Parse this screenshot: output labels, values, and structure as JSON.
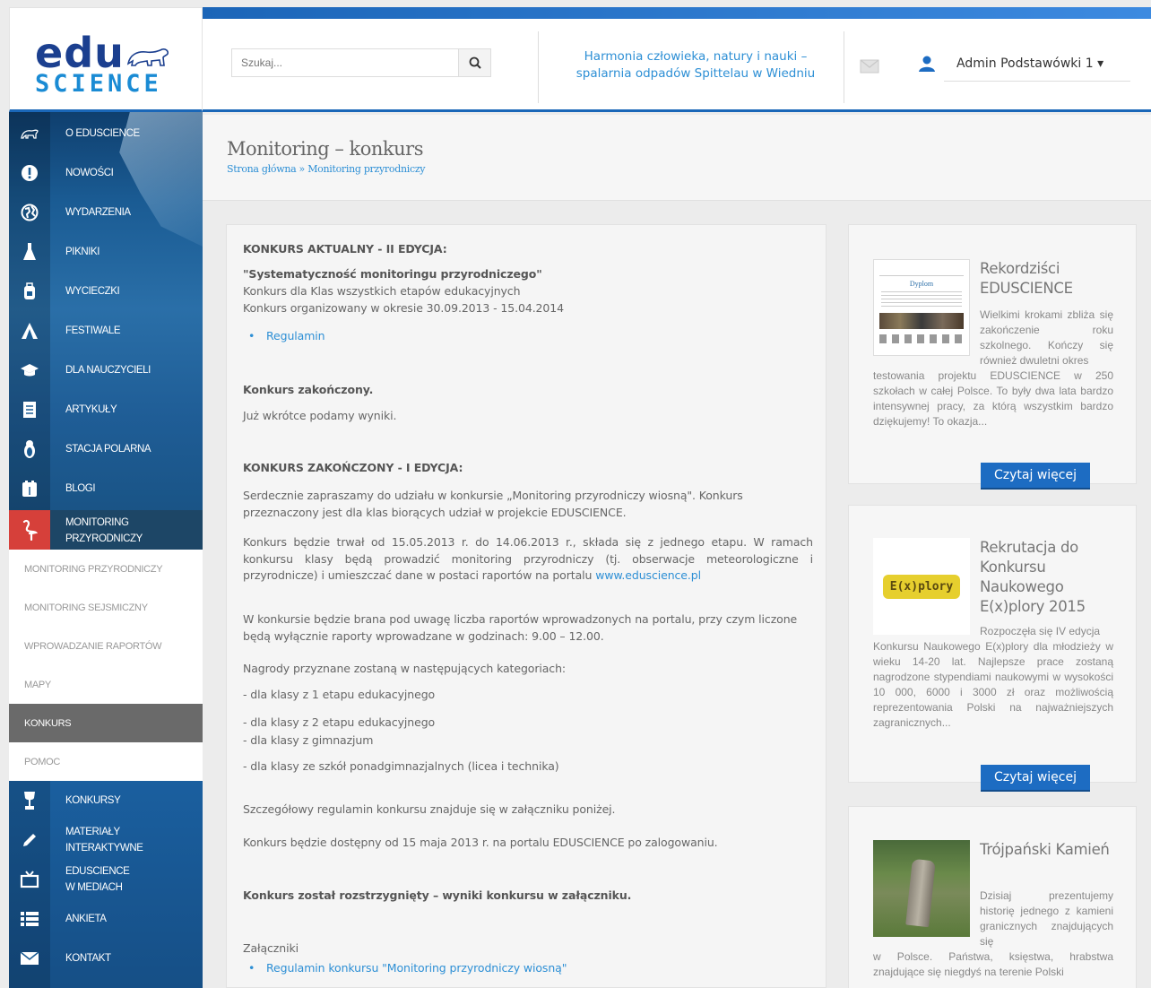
{
  "brand": {
    "logo_top": "edu",
    "logo_bottom": "SCIENCE"
  },
  "search": {
    "placeholder": "Szukaj..."
  },
  "headline": {
    "line1": "Harmonia człowieka, natury i nauki –",
    "line2": "spalarnia odpadów Spittelau w Wiedniu"
  },
  "user": {
    "label": "Admin Podstawówki 1 ▾"
  },
  "sidebar": {
    "top_items": [
      {
        "label": "O EDUSCIENCE",
        "icon": "bear-icon"
      },
      {
        "label": "NOWOŚCI",
        "icon": "exclamation-icon"
      },
      {
        "label": "WYDARZENIA",
        "icon": "globe-icon"
      },
      {
        "label": "PIKNIKI",
        "icon": "flask-icon"
      },
      {
        "label": "WYCIECZKI",
        "icon": "backpack-icon"
      },
      {
        "label": "FESTIWALE",
        "icon": "tent-icon"
      },
      {
        "label": "DLA NAUCZYCIELI",
        "icon": "graduation-cap-icon"
      },
      {
        "label": "ARTYKUŁY",
        "icon": "document-icon"
      },
      {
        "label": "STACJA POLARNA",
        "icon": "penguin-icon"
      },
      {
        "label": "BLOGI",
        "icon": "blog-icon"
      }
    ],
    "active": {
      "line1": "MONITORING",
      "line2": "PRZYRODNICZY",
      "icon": "flamingo-icon"
    },
    "sub_items": [
      "MONITORING PRZYRODNICZY",
      "MONITORING SEJSMICZNY",
      "WPROWADZANIE RAPORTÓW",
      "MAPY",
      "KONKURS",
      "POMOC"
    ],
    "bottom_items": [
      {
        "line1": "KONKURSY",
        "line2": "",
        "icon": "trophy-icon"
      },
      {
        "line1": "MATERIAŁY",
        "line2": "INTERAKTYWNE",
        "icon": "pencil-icon"
      },
      {
        "line1": "EDUSCIENCE",
        "line2": "W MEDIACH",
        "icon": "tv-icon"
      },
      {
        "line1": "ANKIETA",
        "line2": "",
        "icon": "list-icon"
      },
      {
        "line1": "KONTAKT",
        "line2": "",
        "icon": "envelope-icon"
      }
    ]
  },
  "page": {
    "title": "Monitoring – konkurs",
    "breadcrumb": "Strona główna » Monitoring przyrodniczy"
  },
  "article": {
    "h1": "KONKURS AKTUALNY - II EDYCJA:",
    "quote": "\"Systematyczność monitoringu przyrodniczego\"",
    "line_a": "Konkurs dla Klas wszystkich etapów edukacyjnych",
    "line_b": "Konkurs organizowany w okresie 30.09.2013 - 15.04.2014",
    "regulamin": "Regulamin",
    "ended_bold": "Konkurs zakończony.",
    "soon": "Już wkrótce podamy wyniki.",
    "h2": "KONKURS ZAKOŃCZONY - I EDYCJA:",
    "p1": "Serdecznie zapraszamy do udziału w konkursie „Monitoring przyrodniczy wiosną\". Konkurs przeznaczony jest dla klas biorących udział w projekcie EDUSCIENCE.",
    "p2": "Konkurs będzie trwał od 15.05.2013 r. do 14.06.2013 r., składa się z jednego etapu. W ramach konkursu klasy będą prowadzić monitoring przyrodniczy (tj. obserwacje meteorologiczne i przyrodnicze) i umieszczać dane w postaci raportów na portalu",
    "p2_link": "www.eduscience.pl",
    "p3": "W konkursie będzie brana pod uwagę liczba raportów wprowadzonych na portalu, przy czym liczone będą wyłącznie raporty wprowadzane w godzinach: 9.00 – 12.00.",
    "p4": "Nagrody przyznane zostaną w następujących kategoriach:",
    "cat1": "- dla klasy z 1 etapu edukacyjnego",
    "cat2": "- dla klasy z 2 etapu edukacyjnego",
    "cat3": "- dla klasy z gimnazjum",
    "cat4": "- dla klasy ze szkół ponadgimnazjalnych (licea i technika)",
    "p5": "Szczegółowy regulamin konkursu znajduje się w załączniku poniżej.",
    "p6": "Konkurs będzie dostępny od 15 maja 2013 r. na portalu EDUSCIENCE po zalogowaniu.",
    "p7": "Konkurs został rozstrzygnięty – wyniki konkursu w załączniku.",
    "att_label": "Załączniki",
    "att_link": "Regulamin konkursu \"Monitoring przyrodniczy wiosną\""
  },
  "side": [
    {
      "title": "Rekordziści EDUSCIENCE",
      "text_a": "Wielkimi krokami zbliża się zakończenie roku szkolnego. Kończy się również dwuletni okres",
      "text_b": "testowania projektu EDUSCIENCE w 250 szkołach w całej Polsce. To były dwa lata bardzo intensywnej pracy, za którą wszystkim bardzo dziękujemy! To okazja...",
      "button": "Czytaj więcej",
      "img_text": "Dyplom"
    },
    {
      "title": "Rekrutacja do Konkursu Naukowego E(x)plory 2015",
      "text_a": "Rozpoczęła się IV edycja",
      "text_b": "Konkursu Naukowego E(x)plory dla młodzieży w wieku 14-20 lat. Najlepsze prace zostaną nagrodzone stypendiami naukowymi w wysokości 10 000, 6000 i 3000 zł oraz możliwością reprezentowania Polski na najważniejszych zagranicznych...",
      "button": "Czytaj więcej",
      "img_text": "E(x)plory"
    },
    {
      "title": "Trójpański Kamień",
      "text_a": "Dzisiaj prezentujemy historię jednego z kamieni granicznych znajdujących się",
      "text_b": "w Polsce. Państwa, księstwa, hrabstwa znajdujące się niegdyś na terenie Polski",
      "button": ""
    }
  ],
  "colors": {
    "accent": "#1d6cc2",
    "active_red": "#d6403a",
    "link": "#2d8fd5"
  }
}
